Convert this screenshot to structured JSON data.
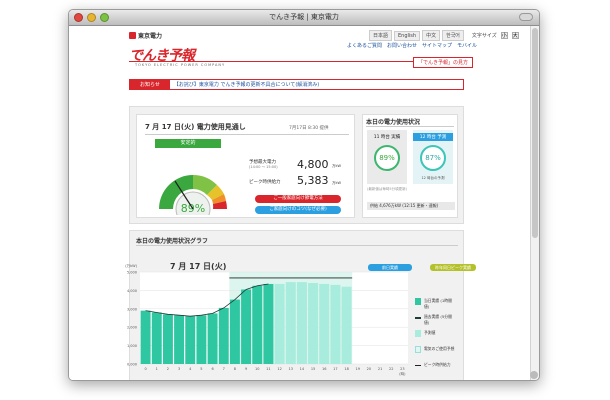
{
  "window": {
    "title": "でんき予報 | 東京電力"
  },
  "header": {
    "logo_text": "東京電力",
    "brand": "でんき予報",
    "brand_sub": "TOKYO ELECTRIC POWER COMPANY",
    "languages": [
      "日本語",
      "English",
      "中文",
      "한국어"
    ],
    "font_size_label": "文字サイズ",
    "font_size_options": [
      "小",
      "大"
    ],
    "nav": [
      "よくあるご質問",
      "お問い合わせ",
      "サイトマップ",
      "モバイル"
    ],
    "denki_button": "「でんき予報」の見方"
  },
  "notice": {
    "label": "お知らせ",
    "text": "【お詫び】東京電力 でんき予報の更新不具合について(解消済み)"
  },
  "forecast": {
    "date": "7 月 17 日(火) 電力使用見通し",
    "updated": "7月17日 8:30 提供",
    "status": "安定的",
    "percent": "89%",
    "peak_label": "予想最大電力",
    "peak_time": "(14:00 〜 15:00)",
    "peak_value": "4,800",
    "peak_unit": "万kW",
    "supply_label": "ピーク時供給力",
    "supply_value": "5,383",
    "supply_unit": "万kW",
    "button_red": "ご一般家庭向け節電方法",
    "button_blue": "ご家庭向けのコツ(なぜ必要)"
  },
  "today": {
    "title": "本日の電力使用状況",
    "actual_head": "11 時台 実績",
    "actual_percent": "89%",
    "actual_foot": "",
    "forecast_head": "12 時台 予測",
    "forecast_percent": "87%",
    "forecast_foot": "12 時台の予測",
    "note": "(最新値は毎時5分頃更新)",
    "supply": "供給 4,676万kW (12:15 更新・速報)"
  },
  "graph": {
    "title": "本日の電力使用状況グラフ",
    "date": "7 月 17 日(火)",
    "btn_prev": "前日実績",
    "btn_peak": "昨年同日ピーク実績",
    "legend": [
      "当日実績 (1時間値)",
      "過去実績 (5分間値)",
      "予測値",
      "電気のご使用予想",
      "ピーク時供給力"
    ]
  },
  "colors": {
    "brand_red": "#d9262c",
    "green": "#3aa83f",
    "teal": "#2fc7a1",
    "blue": "#2b9fe0"
  },
  "chart_data": {
    "type": "bar",
    "categories": [
      "0",
      "1",
      "2",
      "3",
      "4",
      "5",
      "6",
      "7",
      "8",
      "9",
      "10",
      "11",
      "12",
      "13",
      "14",
      "15",
      "16",
      "17",
      "18",
      "19",
      "20",
      "21",
      "22",
      "23"
    ],
    "series": [
      {
        "name": "当日実績",
        "values": [
          2900,
          2800,
          2700,
          2650,
          2600,
          2650,
          2750,
          3050,
          3500,
          4050,
          4250,
          4350,
          null,
          null,
          null,
          null,
          null,
          null,
          null,
          null,
          null,
          null,
          null,
          null
        ]
      },
      {
        "name": "予測値",
        "values": [
          null,
          null,
          null,
          null,
          null,
          null,
          null,
          null,
          null,
          null,
          null,
          null,
          4350,
          4450,
          4450,
          4400,
          4350,
          4300,
          4200,
          null,
          null,
          null,
          null,
          null
        ]
      }
    ],
    "supply": 4676,
    "ylim": [
      0,
      5000
    ],
    "xlabel": "(時)",
    "ylabel": "(万kW)"
  }
}
